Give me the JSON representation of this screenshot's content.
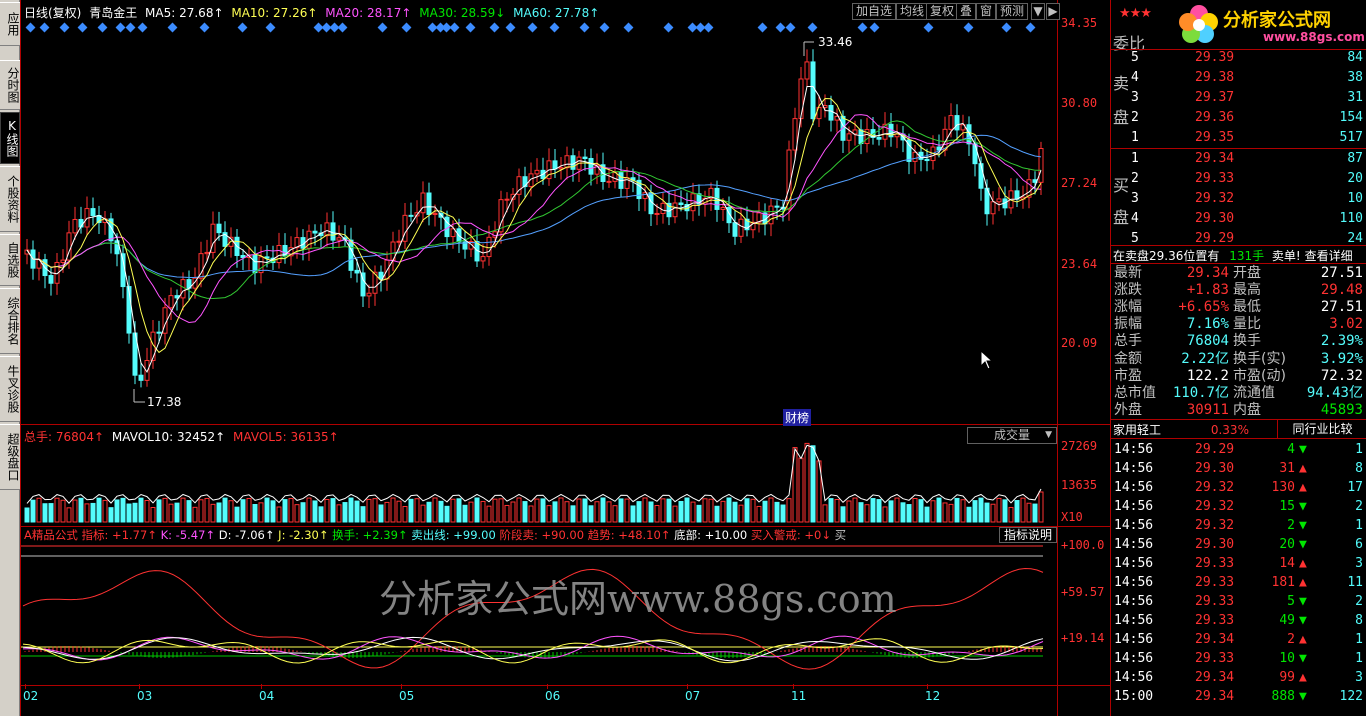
{
  "left_tabs": [
    {
      "label": "应用",
      "active": false
    },
    {
      "label": "分时图",
      "active": false
    },
    {
      "label": "K线图",
      "active": true
    },
    {
      "label": "个股资料",
      "active": false
    },
    {
      "label": "自选股",
      "active": false
    },
    {
      "label": "综合排名",
      "active": false
    },
    {
      "label": "牛叉诊股",
      "active": false
    },
    {
      "label": "超级盘口",
      "active": false
    }
  ],
  "main_chart": {
    "period": "日线(复权)",
    "stock_name": "青岛金王",
    "ma5": "MA5: 27.68↑",
    "ma10": "MA10: 27.26↑",
    "ma20": "MA20: 28.17↑",
    "ma30": "MA30: 28.59↓",
    "ma60": "MA60: 27.78↑",
    "price_axis": [
      "34.35",
      "30.80",
      "27.24",
      "23.64",
      "20.09"
    ],
    "high_mark": "33.46",
    "low_mark": "17.38",
    "rank_tag": "财榜",
    "toolbar": [
      "加自选",
      "均线",
      "复权",
      "叠",
      "窗",
      "预测"
    ]
  },
  "volume_panel": {
    "total": "总手: 76804↑",
    "mavol10": "MAVOL10: 32452↑",
    "mavol5": "MAVOL5: 36135↑",
    "selector": "成交量",
    "axis": [
      "27269",
      "13635",
      "X10"
    ]
  },
  "indicator_panel": {
    "name": "A精品公式",
    "zhibiao": "指标: +1.77↑",
    "k": "K: -5.47↑",
    "d": "D: -7.06↑",
    "j": "J: -2.30↑",
    "huanshou": "换手: +2.39↑",
    "maichuxian": "卖出线: +99.00",
    "jieduanmai": "阶段卖: +90.00",
    "qushi": "趋势: +48.10↑",
    "dibu": "底部: +10.00",
    "mairujingjie": "买入警戒: +0↓",
    "mai": "买",
    "explain_button": "指标说明",
    "axis": [
      "+100.0",
      "+59.57",
      "+19.14"
    ],
    "watermark": "分析家公式网www.88gs.com"
  },
  "months": [
    "02",
    "03",
    "04",
    "05",
    "06",
    "07",
    "11",
    "12"
  ],
  "logo": {
    "text": "分析家公式网",
    "url": "www.88gs.com",
    "stars": "★★★"
  },
  "order_book": {
    "header": "委比",
    "sell_label": [
      "卖",
      "盘"
    ],
    "buy_label": [
      "买",
      "盘"
    ],
    "sell": [
      {
        "lvl": "5",
        "price": "29.39",
        "vol": "84"
      },
      {
        "lvl": "4",
        "price": "29.38",
        "vol": "38"
      },
      {
        "lvl": "3",
        "price": "29.37",
        "vol": "31"
      },
      {
        "lvl": "2",
        "price": "29.36",
        "vol": "154"
      },
      {
        "lvl": "1",
        "price": "29.35",
        "vol": "517"
      }
    ],
    "buy": [
      {
        "lvl": "1",
        "price": "29.34",
        "vol": "87"
      },
      {
        "lvl": "2",
        "price": "29.33",
        "vol": "20"
      },
      {
        "lvl": "3",
        "price": "29.32",
        "vol": "10"
      },
      {
        "lvl": "4",
        "price": "29.30",
        "vol": "110"
      },
      {
        "lvl": "5",
        "price": "29.29",
        "vol": "24"
      }
    ]
  },
  "notice": {
    "text1": "在卖盘29.36位置有",
    "text2": "131手",
    "text3": "卖单!",
    "link": "查看详细"
  },
  "quote": [
    {
      "l1": "最新",
      "v1": "29.34",
      "c1": "red",
      "l2": "开盘",
      "v2": "27.51",
      "c2": "white"
    },
    {
      "l1": "涨跌",
      "v1": "+1.83",
      "c1": "red",
      "l2": "最高",
      "v2": "29.48",
      "c2": "red"
    },
    {
      "l1": "涨幅",
      "v1": "+6.65%",
      "c1": "red",
      "l2": "最低",
      "v2": "27.51",
      "c2": "white"
    },
    {
      "l1": "振幅",
      "v1": "7.16%",
      "c1": "cyan",
      "l2": "量比",
      "v2": "3.02",
      "c2": "red"
    },
    {
      "l1": "总手",
      "v1": "76804",
      "c1": "cyan",
      "l2": "换手",
      "v2": "2.39%",
      "c2": "cyan"
    },
    {
      "l1": "金额",
      "v1": "2.22亿",
      "c1": "cyan",
      "l2": "换手(实)",
      "v2": "3.92%",
      "c2": "cyan"
    },
    {
      "l1": "市盈",
      "v1": "122.2",
      "c1": "white",
      "l2": "市盈(动)",
      "v2": "72.32",
      "c2": "white"
    },
    {
      "l1": "总市值",
      "v1": "110.7亿",
      "c1": "cyan",
      "l2": "流通值",
      "v2": "94.43亿",
      "c2": "cyan"
    },
    {
      "l1": "外盘",
      "v1": "30911",
      "c1": "red",
      "l2": "内盘",
      "v2": "45893",
      "c2": "green"
    }
  ],
  "industry": {
    "name": "家用轻工",
    "change": "0.33%",
    "compare": "同行业比较"
  },
  "ticks": [
    {
      "time": "14:56",
      "price": "29.29",
      "vol": "4",
      "dir": "down",
      "n": "1"
    },
    {
      "time": "14:56",
      "price": "29.30",
      "vol": "31",
      "dir": "up",
      "n": "8"
    },
    {
      "time": "14:56",
      "price": "29.32",
      "vol": "130",
      "dir": "up",
      "n": "17"
    },
    {
      "time": "14:56",
      "price": "29.32",
      "vol": "15",
      "dir": "down",
      "n": "2"
    },
    {
      "time": "14:56",
      "price": "29.32",
      "vol": "2",
      "dir": "down",
      "n": "1"
    },
    {
      "time": "14:56",
      "price": "29.30",
      "vol": "20",
      "dir": "down",
      "n": "6"
    },
    {
      "time": "14:56",
      "price": "29.33",
      "vol": "14",
      "dir": "up",
      "n": "3"
    },
    {
      "time": "14:56",
      "price": "29.33",
      "vol": "181",
      "dir": "up",
      "n": "11"
    },
    {
      "time": "14:56",
      "price": "29.33",
      "vol": "5",
      "dir": "down",
      "n": "2"
    },
    {
      "time": "14:56",
      "price": "29.33",
      "vol": "49",
      "dir": "down",
      "n": "8"
    },
    {
      "time": "14:56",
      "price": "29.34",
      "vol": "2",
      "dir": "up",
      "n": "1"
    },
    {
      "time": "14:56",
      "price": "29.33",
      "vol": "10",
      "dir": "down",
      "n": "1"
    },
    {
      "time": "14:56",
      "price": "29.34",
      "vol": "99",
      "dir": "up",
      "n": "3"
    },
    {
      "time": "15:00",
      "price": "29.34",
      "vol": "888",
      "dir": "down",
      "n": "122"
    }
  ]
}
